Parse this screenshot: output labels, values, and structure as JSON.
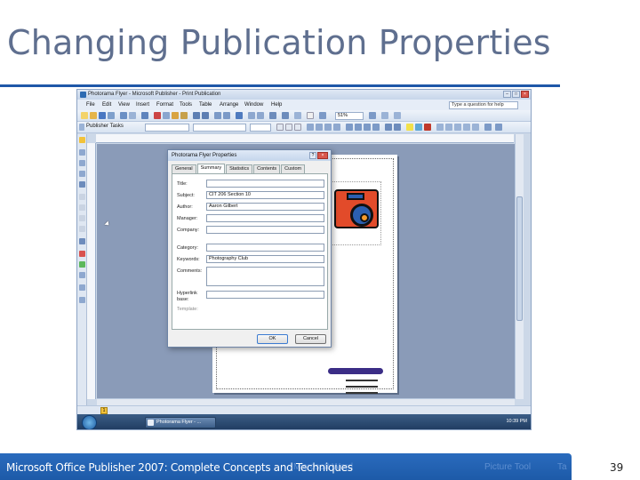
{
  "slide": {
    "title": "Changing Publication Properties",
    "footer": "Microsoft Office Publisher 2007: Complete Concepts and Techniques",
    "page_number": "39",
    "footer_ghost_1": "Microsoft Word",
    "footer_ghost_2": "Picture Tool",
    "footer_ghost_3": "Ta"
  },
  "colors": {
    "title_text": "#5f6f8f",
    "rule": "#1e57a8",
    "footer_bar": "#1d5aa8",
    "workspace": "#8a9bb8"
  },
  "window": {
    "title": "Photorama Flyer - Microsoft Publisher - Print Publication",
    "help_search_placeholder": "Type a question for help",
    "menu": [
      "File",
      "Edit",
      "View",
      "Insert",
      "Format",
      "Tools",
      "Table",
      "Arrange",
      "Window",
      "Help"
    ],
    "zoom": "51%",
    "publisher_tasks": "Publisher Tasks",
    "page_indicator": "1"
  },
  "dialog": {
    "title": "Photorama Flyer Properties",
    "tabs": [
      "General",
      "Summary",
      "Statistics",
      "Contents",
      "Custom"
    ],
    "active_tab": "Summary",
    "fields": {
      "title_label": "Title:",
      "title_value": "",
      "subject_label": "Subject:",
      "subject_value": "CIT 206 Section 10",
      "author_label": "Author:",
      "author_value": "Aaron Gilbert",
      "manager_label": "Manager:",
      "manager_value": "",
      "company_label": "Company:",
      "company_value": "",
      "category_label": "Category:",
      "category_value": "",
      "keywords_label": "Keywords:",
      "keywords_value": "Photography Club",
      "comments_label": "Comments:",
      "hyperlink_label_1": "Hyperlink",
      "hyperlink_label_2": "base:",
      "hyperlink_value": "",
      "template_label": "Template:"
    },
    "ok_label": "OK",
    "cancel_label": "Cancel"
  },
  "taskbar": {
    "task_button": "Photorama Flyer - ...",
    "clock": "10:39 PM"
  }
}
